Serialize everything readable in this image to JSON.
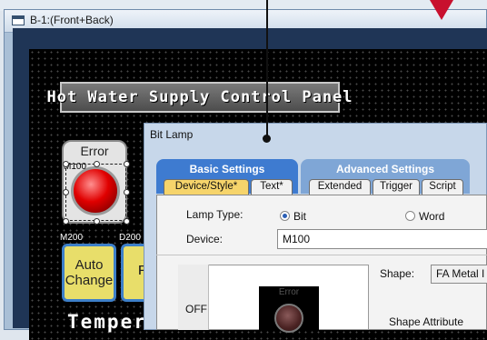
{
  "window": {
    "title": "B-1:(Front+Back)"
  },
  "screen": {
    "panel_title": "Hot Water Supply Control Panel",
    "error_lamp": {
      "label": "Error",
      "device": "M100"
    },
    "auto_button": {
      "device": "M200",
      "line1": "Auto",
      "line2": "Change"
    },
    "pu_button": {
      "device": "D200",
      "line1": "Pu",
      "line2": "F"
    },
    "temperature_text": "Temper"
  },
  "dialog": {
    "title": "Bit Lamp",
    "tab_groups": {
      "basic": "Basic Settings",
      "advanced": "Advanced Settings"
    },
    "tabs": [
      "Device/Style*",
      "Text*",
      "Extended",
      "Trigger",
      "Script"
    ],
    "active_tab": "Device/Style*",
    "lamp_type": {
      "label": "Lamp Type:",
      "options": [
        "Bit",
        "Word"
      ],
      "selected": "Bit"
    },
    "device": {
      "label": "Device:",
      "value": "M100"
    },
    "preview": {
      "state_label": "OFF",
      "lamp_text": "Error"
    },
    "shape": {
      "label": "Shape:",
      "value": "FA Metal I"
    },
    "shape_attribute": "Shape Attribute"
  }
}
